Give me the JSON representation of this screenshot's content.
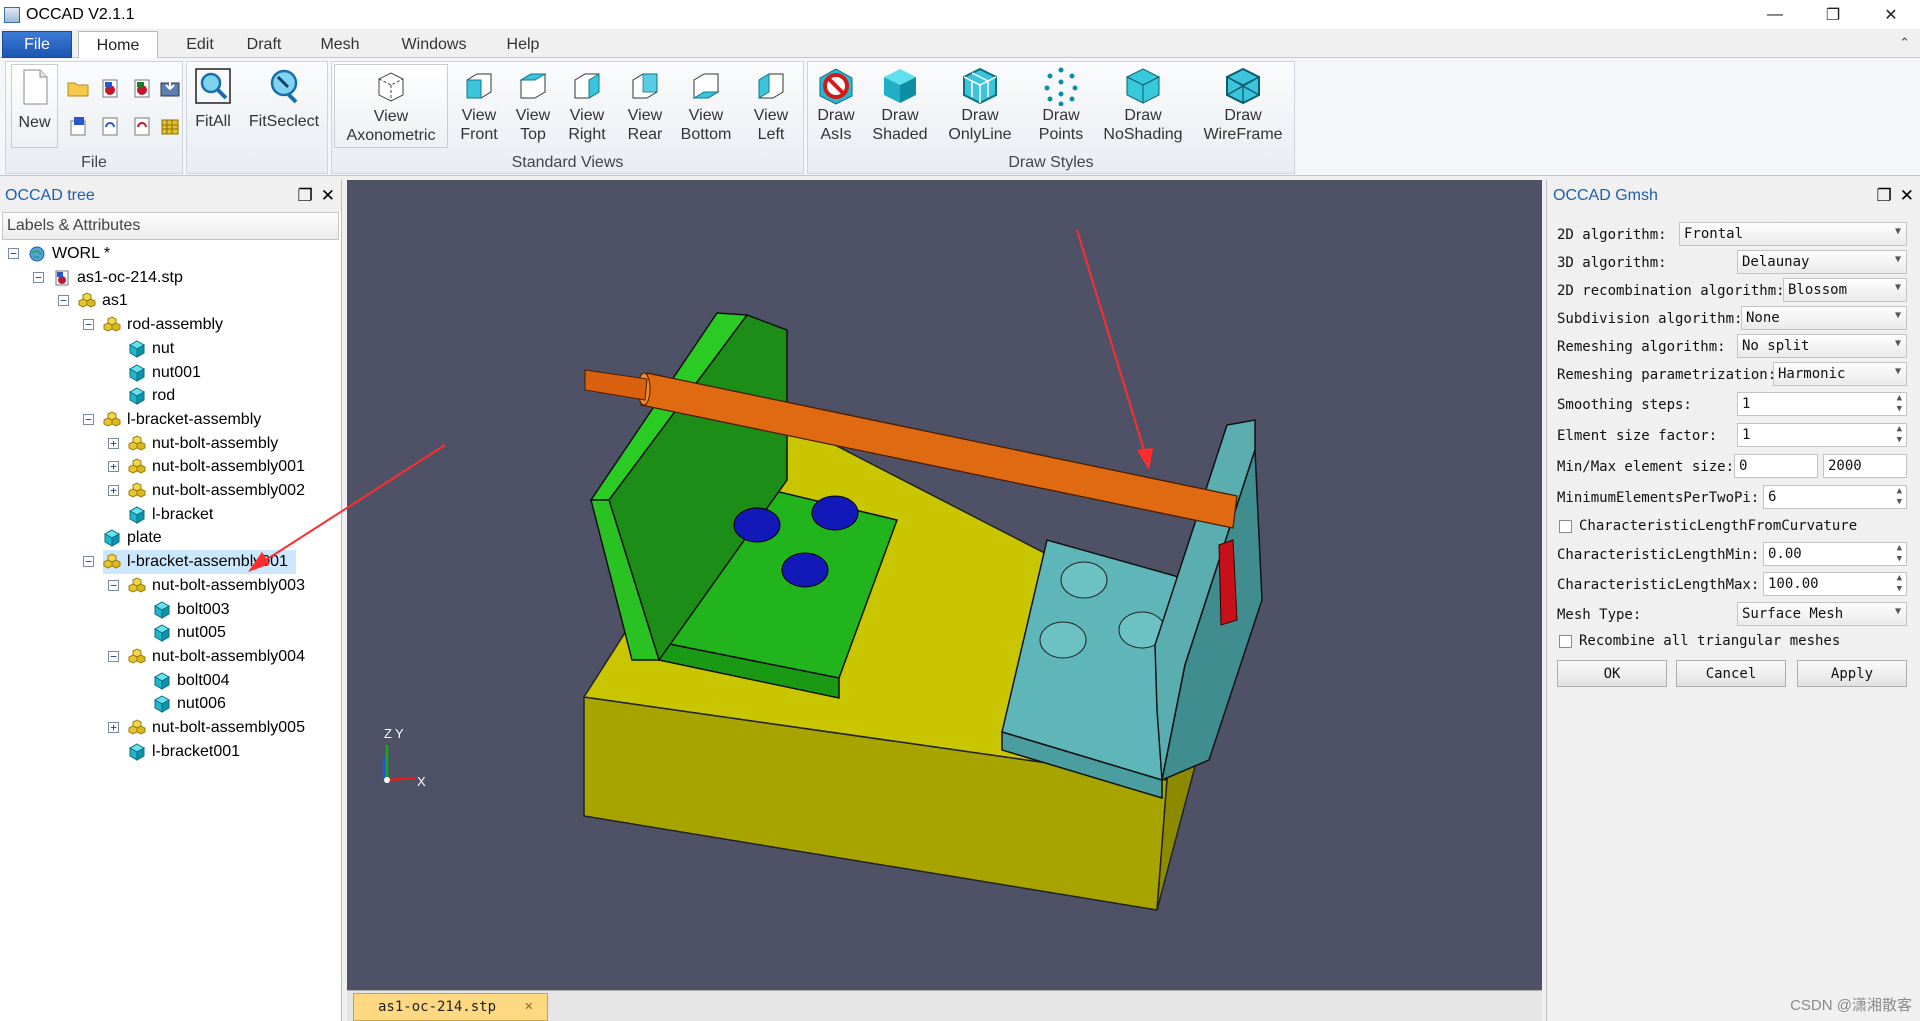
{
  "window": {
    "title": "OCCAD V2.1.1",
    "minimize": "—",
    "maximize": "❐",
    "close": "✕"
  },
  "menu": {
    "file": "File",
    "home": "Home",
    "edit": "Edit",
    "draft": "Draft",
    "mesh": "Mesh",
    "windows": "Windows",
    "help": "Help",
    "collapse": "⌃"
  },
  "ribbon": {
    "file_group": {
      "label": "File",
      "new": "New"
    },
    "fit_all": "FitAll",
    "fit_select": "FitSeclect",
    "standard_views": {
      "label": "Standard Views",
      "axonometric": [
        "View",
        "Axonometric"
      ],
      "front": [
        "View",
        "Front"
      ],
      "top": [
        "View",
        "Top"
      ],
      "right": [
        "View",
        "Right"
      ],
      "rear": [
        "View",
        "Rear"
      ],
      "bottom": [
        "View",
        "Bottom"
      ],
      "left": [
        "View",
        "Left"
      ]
    },
    "draw_styles": {
      "label": "Draw Styles",
      "asis": [
        "Draw",
        "AsIs"
      ],
      "shaded": [
        "Draw",
        "Shaded"
      ],
      "onlyline": [
        "Draw",
        "OnlyLine"
      ],
      "points": [
        "Draw",
        "Points"
      ],
      "noshading": [
        "Draw",
        "NoShading"
      ],
      "wireframe": [
        "Draw",
        "WireFrame"
      ]
    }
  },
  "tree_panel": {
    "title": "OCCAD tree",
    "column": "Labels & Attributes",
    "nodes": [
      {
        "label": "WORL *",
        "icon": "globe-icon",
        "exp": "−"
      },
      {
        "label": "as1-oc-214.stp",
        "icon": "step-file-icon",
        "exp": "−"
      },
      {
        "label": "as1",
        "icon": "assembly-icon",
        "exp": "−"
      },
      {
        "label": "rod-assembly",
        "icon": "assembly-icon",
        "exp": "−"
      },
      {
        "label": "nut",
        "icon": "part-icon",
        "exp": ""
      },
      {
        "label": "nut001",
        "icon": "part-icon",
        "exp": ""
      },
      {
        "label": "rod",
        "icon": "part-icon",
        "exp": ""
      },
      {
        "label": "l-bracket-assembly",
        "icon": "assembly-icon",
        "exp": "−"
      },
      {
        "label": "nut-bolt-assembly",
        "icon": "assembly-icon",
        "exp": "+"
      },
      {
        "label": "nut-bolt-assembly001",
        "icon": "assembly-icon",
        "exp": "+"
      },
      {
        "label": "nut-bolt-assembly002",
        "icon": "assembly-icon",
        "exp": "+"
      },
      {
        "label": "l-bracket",
        "icon": "part-icon",
        "exp": ""
      },
      {
        "label": "plate",
        "icon": "part-icon",
        "exp": ""
      },
      {
        "label": "l-bracket-assembly001",
        "icon": "assembly-icon",
        "exp": "−"
      },
      {
        "label": "nut-bolt-assembly003",
        "icon": "assembly-icon",
        "exp": "−"
      },
      {
        "label": "bolt003",
        "icon": "part-icon",
        "exp": ""
      },
      {
        "label": "nut005",
        "icon": "part-icon",
        "exp": ""
      },
      {
        "label": "nut-bolt-assembly004",
        "icon": "assembly-icon",
        "exp": "−"
      },
      {
        "label": "bolt004",
        "icon": "part-icon",
        "exp": ""
      },
      {
        "label": "nut006",
        "icon": "part-icon",
        "exp": ""
      },
      {
        "label": "nut-bolt-assembly005",
        "icon": "assembly-icon",
        "exp": "+"
      },
      {
        "label": "l-bracket001",
        "icon": "part-icon",
        "exp": ""
      }
    ]
  },
  "viewport": {
    "axis_z": "Z",
    "axis_y": "Y",
    "axis_x": "X"
  },
  "doc_tab": {
    "label": "as1-oc-214.stp",
    "close": "✕"
  },
  "gmsh": {
    "title": "OCCAD Gmsh",
    "algo2d_label": "2D algorithm:",
    "algo2d": "Frontal",
    "algo3d_label": "3D algorithm:",
    "algo3d": "Delaunay",
    "recomb_label": "2D recombination algorithm:",
    "recomb": "Blossom",
    "subdiv_label": "Subdivision algorithm:",
    "subdiv": "None",
    "remesh_label": "Remeshing algorithm:",
    "remesh": "No split",
    "remeshparam_label": "Remeshing parametrization:",
    "remeshparam": "Harmonic",
    "smooth_label": "Smoothing steps:",
    "smooth": "1",
    "sizefactor_label": "Elment size factor:",
    "sizefactor": "1",
    "minmax_label": "Min/Max element size:",
    "minsize": "0",
    "maxsize": "2000",
    "minelem_label": "MinimumElementsPerTwoPi:",
    "minelem": "6",
    "curvature_label": "CharacteristicLengthFromCurvature",
    "clmin_label": "CharacteristicLengthMin:",
    "clmin": "0.00",
    "clmax_label": "CharacteristicLengthMax:",
    "clmax": "100.00",
    "meshtype_label": "Mesh Type:",
    "meshtype": "Surface Mesh",
    "recombine_all_label": "Recombine all triangular meshes",
    "ok": "OK",
    "cancel": "Cancel",
    "apply": "Apply"
  },
  "watermark": "CSDN @潇湘散客"
}
